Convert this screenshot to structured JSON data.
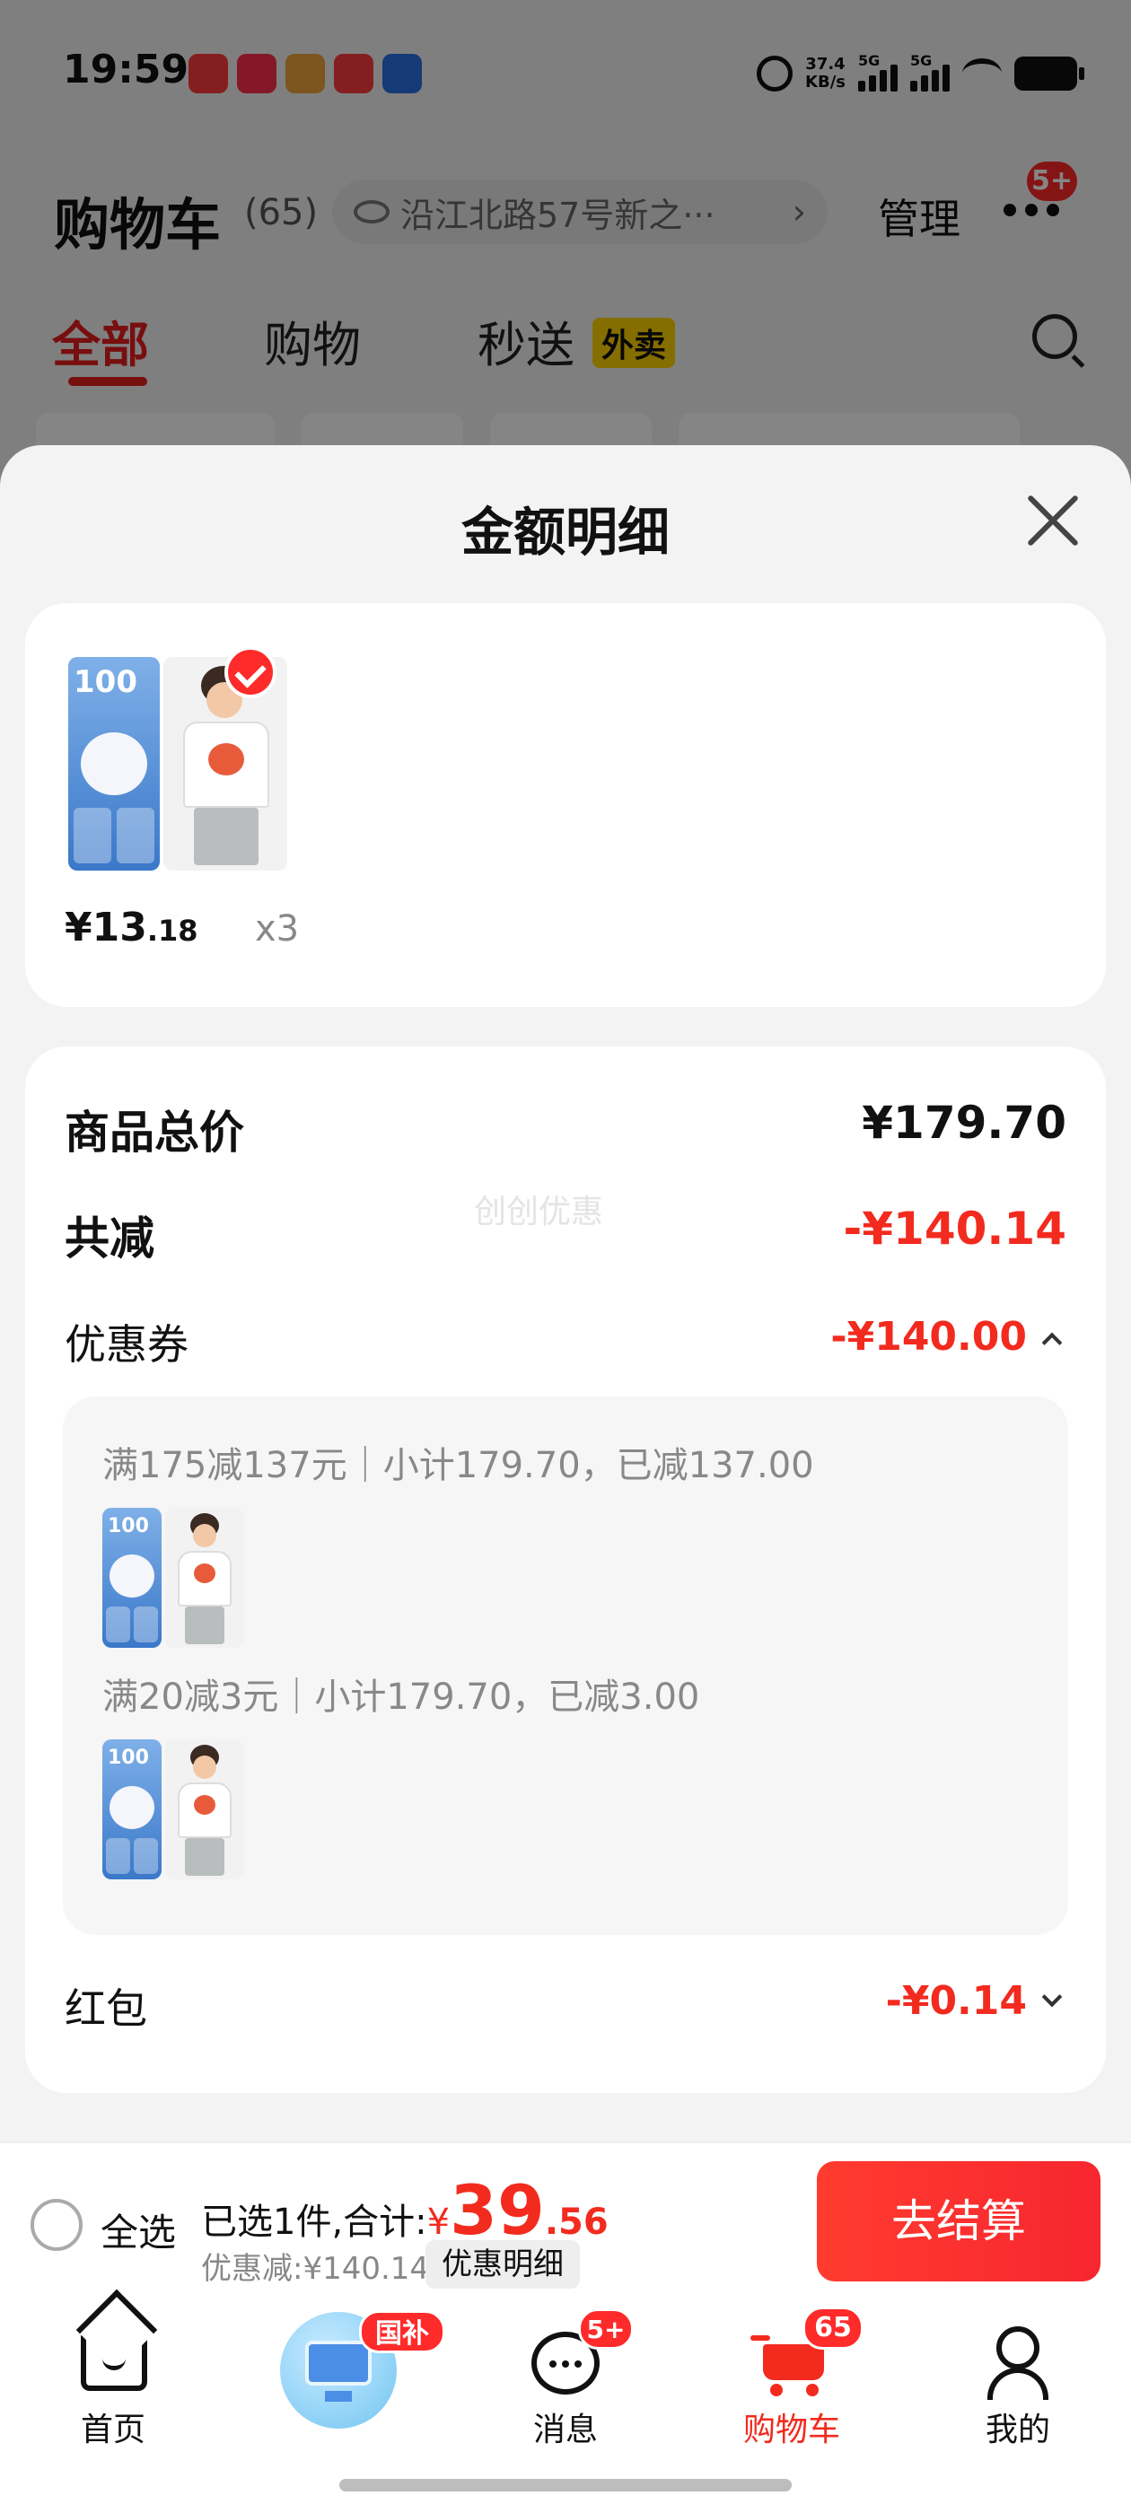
{
  "status_bar": {
    "time": "19:59",
    "net_speed_value": "37.4",
    "net_speed_unit": "KB/s",
    "signal_1": "5G",
    "signal_2": "5G",
    "icons": [
      "app-icon-1",
      "app-icon-2",
      "app-icon-3",
      "app-icon-4",
      "app-icon-5",
      "alarm-icon",
      "wifi-icon",
      "battery-icon"
    ]
  },
  "header": {
    "title": "购物车",
    "count": "(65)",
    "address": "沿江北路57号新之···",
    "manage": "管理",
    "more_badge": "5+"
  },
  "tabs": [
    {
      "label": "全部",
      "active": true
    },
    {
      "label": "购物",
      "active": false
    },
    {
      "label": "秒送",
      "active": false,
      "tag": "外卖"
    }
  ],
  "sheet": {
    "title": "金额明细",
    "product": {
      "price_main": "¥13",
      "price_cents": ".18",
      "qty": "x3"
    },
    "rows": {
      "total_label": "商品总价",
      "total_value": "¥179.70",
      "reduce_label": "共减",
      "reduce_value": "-¥140.14",
      "watermark": "创创优惠",
      "coupon_label": "优惠券",
      "coupon_value": "-¥140.00",
      "redpack_label": "红包",
      "redpack_value": "-¥0.14"
    },
    "coupons": [
      {
        "text": "满175减137元｜小计179.70，已减137.00"
      },
      {
        "text": "满20减3元｜小计179.70，已减3.00"
      }
    ]
  },
  "pay_bar": {
    "select_all": "全选",
    "summary_prefix": "已选1件,合计:",
    "currency": "¥",
    "amount_int": "39",
    "amount_cents": ".56",
    "discount": "优惠减:¥140.14",
    "detail_button": "优惠明细",
    "checkout": "去结算"
  },
  "tab_bar": [
    {
      "label": "首页",
      "icon": "home-icon"
    },
    {
      "label": "",
      "icon": "subsidy-icon",
      "badge": "国补"
    },
    {
      "label": "消息",
      "icon": "message-icon",
      "badge": "5+"
    },
    {
      "label": "购物车",
      "icon": "cart-icon",
      "badge": "65",
      "active": true
    },
    {
      "label": "我的",
      "icon": "profile-icon"
    }
  ],
  "colors": {
    "accent_red": "#f22b1e",
    "tag_yellow": "#ffd400",
    "sheet_bg": "#f3f3f3"
  }
}
